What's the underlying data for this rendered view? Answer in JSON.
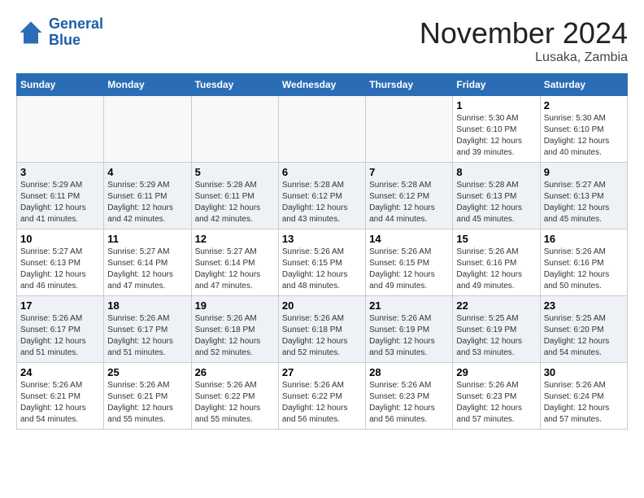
{
  "header": {
    "logo_line1": "General",
    "logo_line2": "Blue",
    "month": "November 2024",
    "location": "Lusaka, Zambia"
  },
  "weekdays": [
    "Sunday",
    "Monday",
    "Tuesday",
    "Wednesday",
    "Thursday",
    "Friday",
    "Saturday"
  ],
  "weeks": [
    [
      {
        "day": "",
        "info": ""
      },
      {
        "day": "",
        "info": ""
      },
      {
        "day": "",
        "info": ""
      },
      {
        "day": "",
        "info": ""
      },
      {
        "day": "",
        "info": ""
      },
      {
        "day": "1",
        "info": "Sunrise: 5:30 AM\nSunset: 6:10 PM\nDaylight: 12 hours\nand 39 minutes."
      },
      {
        "day": "2",
        "info": "Sunrise: 5:30 AM\nSunset: 6:10 PM\nDaylight: 12 hours\nand 40 minutes."
      }
    ],
    [
      {
        "day": "3",
        "info": "Sunrise: 5:29 AM\nSunset: 6:11 PM\nDaylight: 12 hours\nand 41 minutes."
      },
      {
        "day": "4",
        "info": "Sunrise: 5:29 AM\nSunset: 6:11 PM\nDaylight: 12 hours\nand 42 minutes."
      },
      {
        "day": "5",
        "info": "Sunrise: 5:28 AM\nSunset: 6:11 PM\nDaylight: 12 hours\nand 42 minutes."
      },
      {
        "day": "6",
        "info": "Sunrise: 5:28 AM\nSunset: 6:12 PM\nDaylight: 12 hours\nand 43 minutes."
      },
      {
        "day": "7",
        "info": "Sunrise: 5:28 AM\nSunset: 6:12 PM\nDaylight: 12 hours\nand 44 minutes."
      },
      {
        "day": "8",
        "info": "Sunrise: 5:28 AM\nSunset: 6:13 PM\nDaylight: 12 hours\nand 45 minutes."
      },
      {
        "day": "9",
        "info": "Sunrise: 5:27 AM\nSunset: 6:13 PM\nDaylight: 12 hours\nand 45 minutes."
      }
    ],
    [
      {
        "day": "10",
        "info": "Sunrise: 5:27 AM\nSunset: 6:13 PM\nDaylight: 12 hours\nand 46 minutes."
      },
      {
        "day": "11",
        "info": "Sunrise: 5:27 AM\nSunset: 6:14 PM\nDaylight: 12 hours\nand 47 minutes."
      },
      {
        "day": "12",
        "info": "Sunrise: 5:27 AM\nSunset: 6:14 PM\nDaylight: 12 hours\nand 47 minutes."
      },
      {
        "day": "13",
        "info": "Sunrise: 5:26 AM\nSunset: 6:15 PM\nDaylight: 12 hours\nand 48 minutes."
      },
      {
        "day": "14",
        "info": "Sunrise: 5:26 AM\nSunset: 6:15 PM\nDaylight: 12 hours\nand 49 minutes."
      },
      {
        "day": "15",
        "info": "Sunrise: 5:26 AM\nSunset: 6:16 PM\nDaylight: 12 hours\nand 49 minutes."
      },
      {
        "day": "16",
        "info": "Sunrise: 5:26 AM\nSunset: 6:16 PM\nDaylight: 12 hours\nand 50 minutes."
      }
    ],
    [
      {
        "day": "17",
        "info": "Sunrise: 5:26 AM\nSunset: 6:17 PM\nDaylight: 12 hours\nand 51 minutes."
      },
      {
        "day": "18",
        "info": "Sunrise: 5:26 AM\nSunset: 6:17 PM\nDaylight: 12 hours\nand 51 minutes."
      },
      {
        "day": "19",
        "info": "Sunrise: 5:26 AM\nSunset: 6:18 PM\nDaylight: 12 hours\nand 52 minutes."
      },
      {
        "day": "20",
        "info": "Sunrise: 5:26 AM\nSunset: 6:18 PM\nDaylight: 12 hours\nand 52 minutes."
      },
      {
        "day": "21",
        "info": "Sunrise: 5:26 AM\nSunset: 6:19 PM\nDaylight: 12 hours\nand 53 minutes."
      },
      {
        "day": "22",
        "info": "Sunrise: 5:25 AM\nSunset: 6:19 PM\nDaylight: 12 hours\nand 53 minutes."
      },
      {
        "day": "23",
        "info": "Sunrise: 5:25 AM\nSunset: 6:20 PM\nDaylight: 12 hours\nand 54 minutes."
      }
    ],
    [
      {
        "day": "24",
        "info": "Sunrise: 5:26 AM\nSunset: 6:21 PM\nDaylight: 12 hours\nand 54 minutes."
      },
      {
        "day": "25",
        "info": "Sunrise: 5:26 AM\nSunset: 6:21 PM\nDaylight: 12 hours\nand 55 minutes."
      },
      {
        "day": "26",
        "info": "Sunrise: 5:26 AM\nSunset: 6:22 PM\nDaylight: 12 hours\nand 55 minutes."
      },
      {
        "day": "27",
        "info": "Sunrise: 5:26 AM\nSunset: 6:22 PM\nDaylight: 12 hours\nand 56 minutes."
      },
      {
        "day": "28",
        "info": "Sunrise: 5:26 AM\nSunset: 6:23 PM\nDaylight: 12 hours\nand 56 minutes."
      },
      {
        "day": "29",
        "info": "Sunrise: 5:26 AM\nSunset: 6:23 PM\nDaylight: 12 hours\nand 57 minutes."
      },
      {
        "day": "30",
        "info": "Sunrise: 5:26 AM\nSunset: 6:24 PM\nDaylight: 12 hours\nand 57 minutes."
      }
    ]
  ]
}
